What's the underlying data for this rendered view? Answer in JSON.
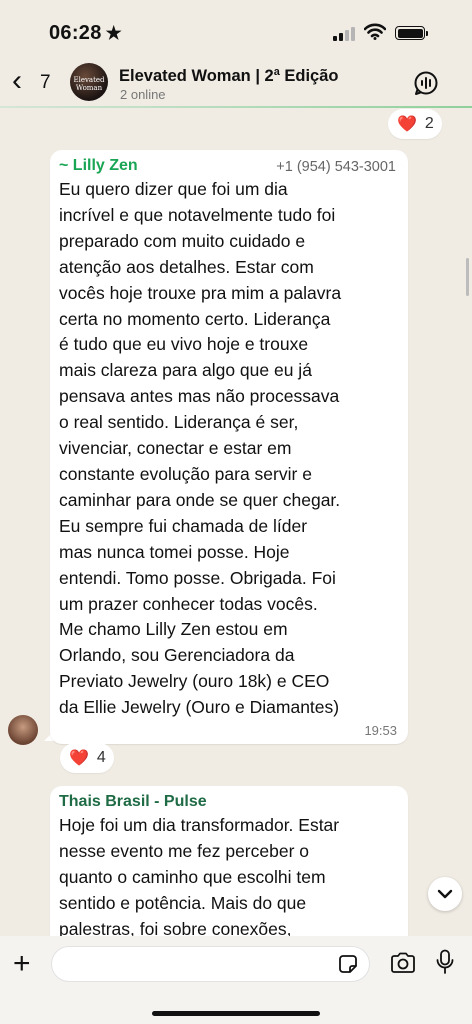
{
  "status_bar": {
    "time": "06:28",
    "star": "★"
  },
  "header": {
    "back_count": "7",
    "avatar_text": "Elevated Woman",
    "title": "Elevated Woman | 2ª Edição",
    "subtitle": "2 online"
  },
  "reaction_top": {
    "emoji": "❤️",
    "count": "2"
  },
  "messages": [
    {
      "sender": "~ Lilly Zen",
      "sender_color": "#1aa555",
      "phone": "+1 (954) 543-3001",
      "lines": [
        "Eu quero dizer que foi um dia",
        "incrível e que notavelmente tudo foi",
        "preparado com muito cuidado e",
        "atenção aos detalhes. Estar com",
        "vocês hoje trouxe pra mim a palavra",
        "certa no momento certo. Liderança",
        "é tudo que eu vivo hoje e trouxe",
        "mais clareza para algo que eu já",
        "pensava antes mas não processava",
        "o real sentido. Liderança é ser,",
        "vivenciar, conectar e estar em",
        "constante evolução para servir e",
        "caminhar para onde se quer chegar.",
        "Eu sempre fui chamada de líder",
        "mas nunca tomei posse. Hoje",
        "entendi. Tomo posse. Obrigada. Foi",
        "um prazer conhecer todas vocês.",
        "Me chamo Lilly Zen estou em",
        "Orlando, sou Gerenciadora da",
        "Previato Jewelry (ouro 18k) e CEO",
        "da Ellie Jewelry (Ouro e Diamantes)"
      ],
      "time": "19:53",
      "reaction": {
        "emoji": "❤️",
        "count": "4"
      }
    },
    {
      "sender": "Thais Brasil - Pulse",
      "sender_color": "#1f6b45",
      "lines": [
        "Hoje foi um dia transformador. Estar",
        "nesse evento me fez perceber o",
        "quanto o caminho que escolhi tem",
        "sentido e potência. Mais do que",
        "palestras, foi sobre conexões,"
      ]
    }
  ],
  "composer": {
    "placeholder": ""
  }
}
